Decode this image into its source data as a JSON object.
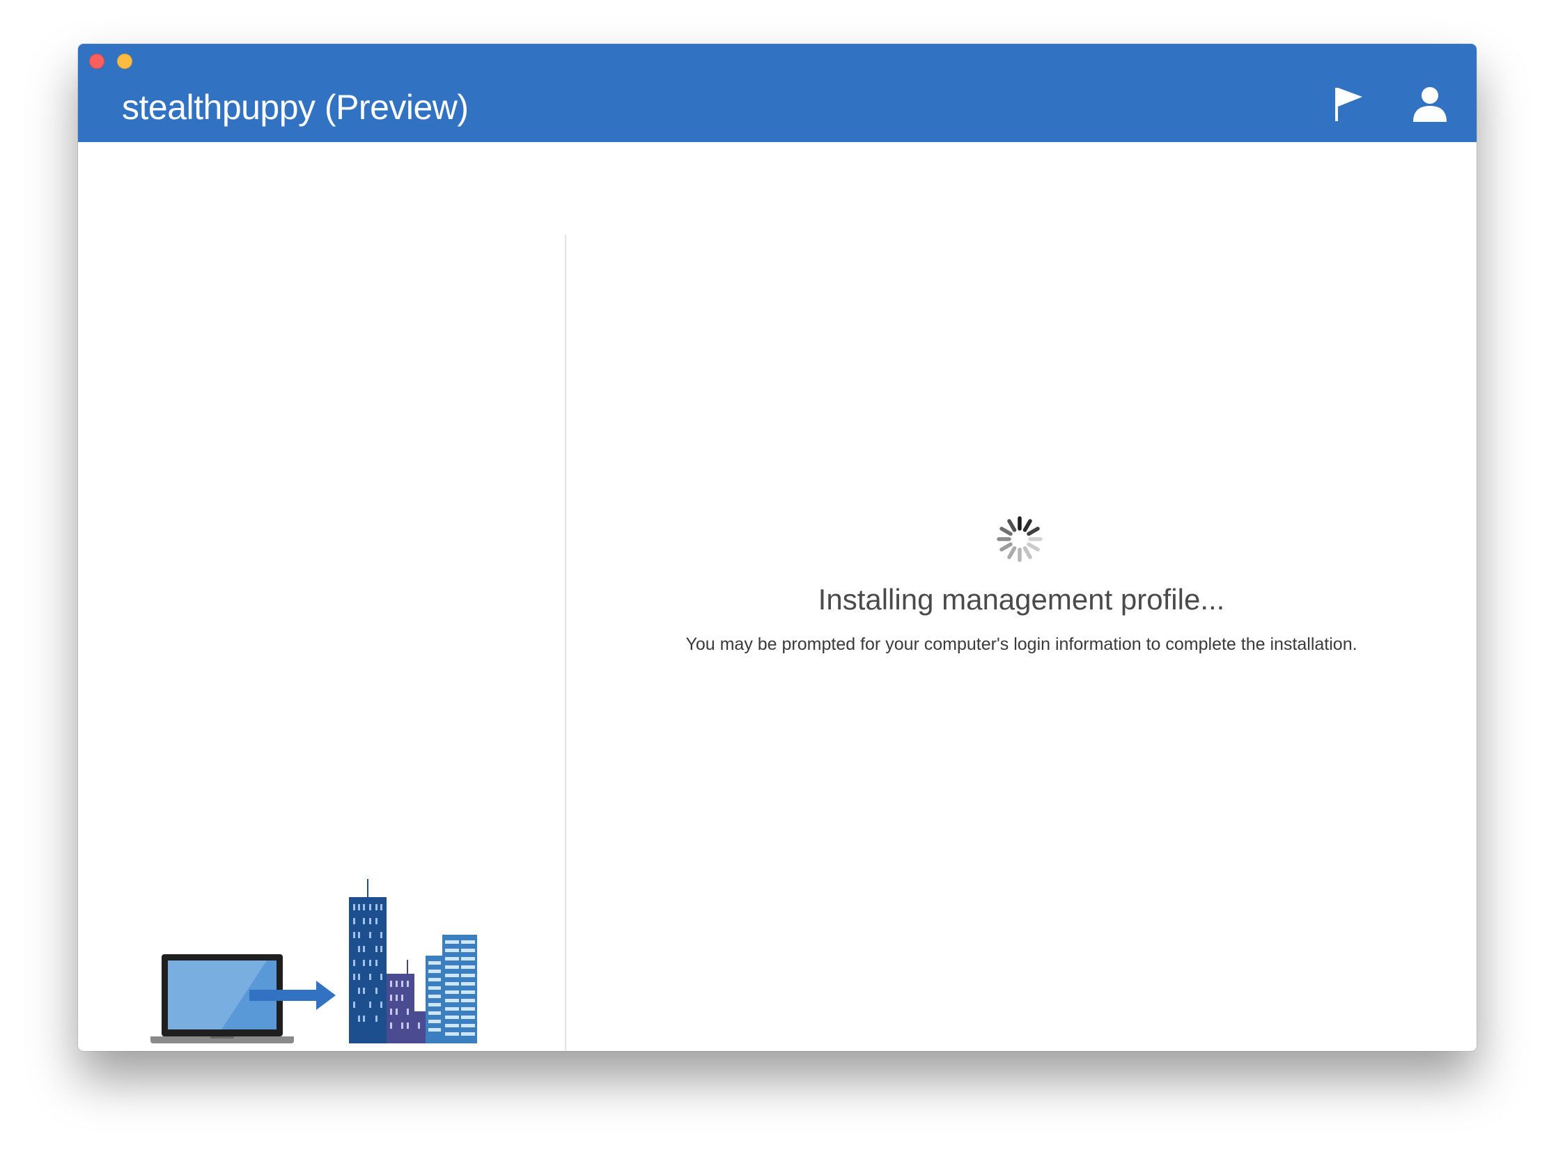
{
  "window": {
    "title": "stealthpuppy (Preview)"
  },
  "header": {
    "buttons": [
      {
        "icon": "flag-icon"
      },
      {
        "icon": "user-icon"
      }
    ]
  },
  "status": {
    "title": "Installing management profile...",
    "subtitle": "You may be prompted for your computer's login information to complete the installation."
  },
  "colors": {
    "titlebar": "#3173c2",
    "accent": "#3173c2",
    "close": "#fc605c",
    "minimize": "#fdbc40"
  }
}
